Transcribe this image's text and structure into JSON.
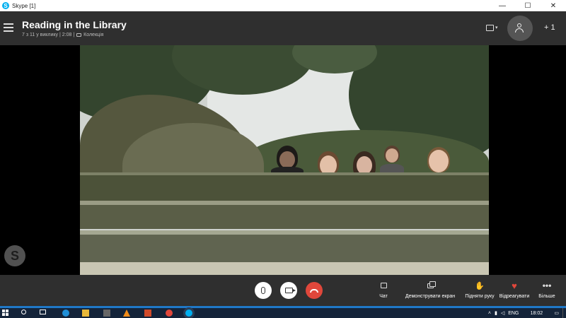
{
  "window": {
    "title": "Skype [1]",
    "minimize_glyph": "—",
    "maximize_glyph": "☐",
    "close_glyph": "✕"
  },
  "call": {
    "title": "Reading in the Library",
    "subtitle": "7 з 11 у виклику | 2:08 |",
    "gallery_label": "Колекція",
    "add_participants_count": "+ 1"
  },
  "controls": {
    "actions": [
      {
        "name": "chat",
        "label": "Чат",
        "icon": "chat-icon"
      },
      {
        "name": "share-screen",
        "label": "Демонструвати екран",
        "icon": "share-screen-icon"
      },
      {
        "name": "raise-hand",
        "label": "Підняти руку",
        "icon": "hand-icon",
        "glyph": "✋"
      },
      {
        "name": "react",
        "label": "Відреагувати",
        "icon": "heart-icon",
        "glyph": "♥"
      },
      {
        "name": "more",
        "label": "Більше",
        "icon": "more-icon",
        "glyph": "•••"
      }
    ]
  },
  "taskbar": {
    "language": "ENG",
    "time": "18:02"
  },
  "colors": {
    "header_bg": "#2f2f2f",
    "hangup_red": "#e0473b",
    "skype_blue": "#00aff0",
    "taskbar_bg": "#14243a"
  }
}
